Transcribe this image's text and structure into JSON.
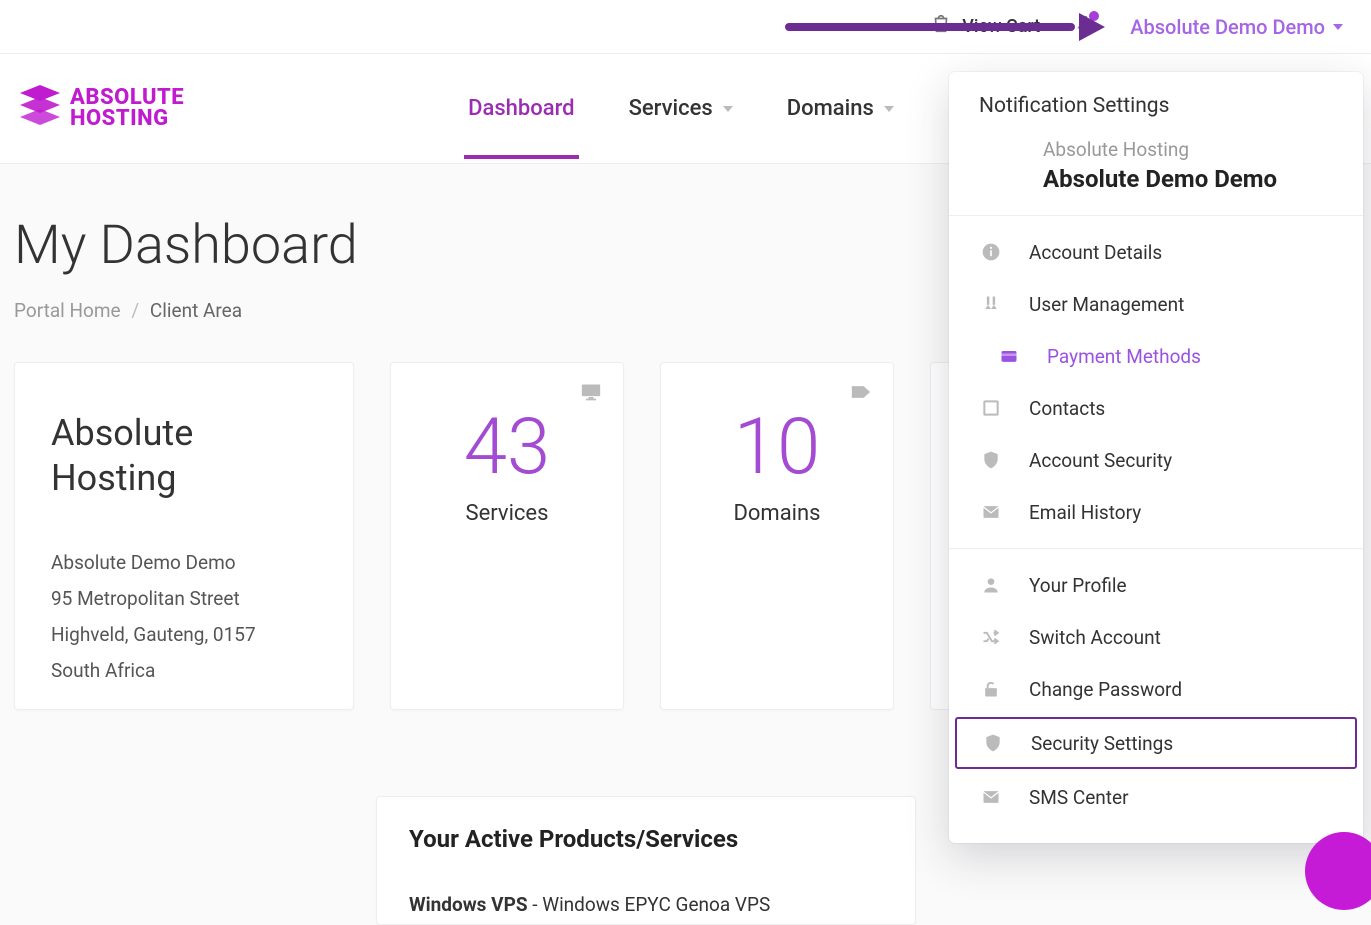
{
  "topbar": {
    "cart_label": "View Cart",
    "user_name": "Absolute Demo Demo"
  },
  "logo": {
    "line1": "ABSOLUTE",
    "line2": "HOSTING"
  },
  "nav": {
    "items": [
      {
        "label": "Dashboard",
        "active": true,
        "caret": false
      },
      {
        "label": "Services",
        "active": false,
        "caret": true
      },
      {
        "label": "Domains",
        "active": false,
        "caret": true
      }
    ]
  },
  "page": {
    "title": "My Dashboard",
    "breadcrumb": {
      "home": "Portal Home",
      "current": "Client Area"
    }
  },
  "profile_card": {
    "heading": "Absolute Hosting",
    "lines": [
      "Absolute Demo Demo",
      "95 Metropolitan Street",
      "Highveld, Gauteng, 0157",
      "South Africa"
    ]
  },
  "stats": [
    {
      "value": "43",
      "label": "Services",
      "icon": "monitor"
    },
    {
      "value": "10",
      "label": "Domains",
      "icon": "tag"
    }
  ],
  "active_products": {
    "heading": "Your Active Products/Services",
    "items": [
      {
        "bold": "Windows VPS",
        "rest": " - Windows EPYC Genoa VPS"
      }
    ]
  },
  "dropdown": {
    "header": "Notification Settings",
    "account": {
      "company": "Absolute Hosting",
      "name": "Absolute Demo Demo"
    },
    "section1": [
      {
        "label": "Account Details",
        "icon": "info"
      },
      {
        "label": "User Management",
        "icon": "users"
      },
      {
        "label": "Payment Methods",
        "icon": "wallet",
        "active": true
      },
      {
        "label": "Contacts",
        "icon": "square"
      },
      {
        "label": "Account Security",
        "icon": "shield"
      },
      {
        "label": "Email History",
        "icon": "mail"
      }
    ],
    "section2": [
      {
        "label": "Your Profile",
        "icon": "person"
      },
      {
        "label": "Switch Account",
        "icon": "shuffle"
      },
      {
        "label": "Change Password",
        "icon": "unlock"
      },
      {
        "label": "Security Settings",
        "icon": "shield-check",
        "highlight": true
      },
      {
        "label": "SMS Center",
        "icon": "envelope"
      }
    ]
  }
}
